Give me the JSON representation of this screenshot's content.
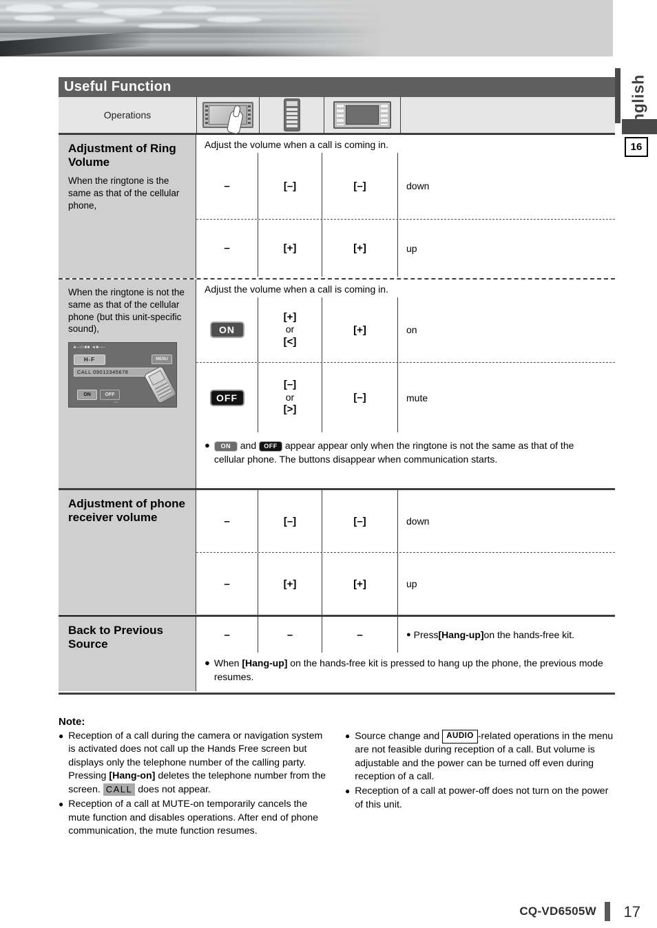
{
  "language_tab": "English",
  "chapter_number": "16",
  "header": {
    "title": "Useful Function",
    "operations_label": "Operations"
  },
  "icons": {
    "touchscreen": "touchscreen-hand-icon",
    "remote": "remote-control-icon",
    "head_unit": "head-unit-panel-icon"
  },
  "sections": [
    {
      "heading": "Adjustment of Ring Volume",
      "subtext": "When the ringtone is the same as that of the cellular phone,",
      "caption": "Adjust the volume when a call is coming in.",
      "rows": [
        {
          "touch": "–",
          "remote": "[–]",
          "unit": "[–]",
          "result": "down"
        },
        {
          "touch": "–",
          "remote": "[+]",
          "unit": "[+]",
          "result": "up"
        }
      ]
    },
    {
      "subtext": "When the ringtone is not the same as that of the cellular phone (but this unit-specific sound),",
      "caption": "Adjust the volume when a call is coming in.",
      "rows": [
        {
          "touch_button": "ON",
          "remote_a": "[+]",
          "remote_or": "or",
          "remote_b": "[<]",
          "unit": "[+]",
          "result": "on"
        },
        {
          "touch_button": "OFF",
          "remote_a": "[–]",
          "remote_or": "or",
          "remote_b": "[>]",
          "unit": "[–]",
          "result": "mute"
        }
      ],
      "note_pre": "",
      "note_mid": "and",
      "note_post": "appear appear only when the ringtone is not the same as that of the cellular phone. The buttons disappear when communication starts.",
      "note_pill_a": "ON",
      "note_pill_b": "OFF",
      "lcd": {
        "statusbar": "◄–‹/‹■■  ◄■–‹–",
        "hf_label": "H-F",
        "menu_label": "MENU",
        "call_text": "CALL  09012345678",
        "on_label": "ON",
        "off_label": "OFF",
        "foot_label": "• •"
      }
    },
    {
      "heading": "Adjustment of phone receiver volume",
      "rows": [
        {
          "touch": "–",
          "remote": "[–]",
          "unit": "[–]",
          "result": "down"
        },
        {
          "touch": "–",
          "remote": "[+]",
          "unit": "[+]",
          "result": "up"
        }
      ]
    },
    {
      "heading": "Back to Previous Source",
      "rows": [
        {
          "touch": "–",
          "remote": "–",
          "unit": "–",
          "result_pre": "Press ",
          "result_bold": "[Hang-up]",
          "result_post": " on the hands-free kit."
        }
      ],
      "note_pre": "When ",
      "note_bold": "[Hang-up]",
      "note_post": " on the hands-free kit is pressed to hang up the phone, the previous mode resumes."
    }
  ],
  "notes": {
    "title": "Note:",
    "left": [
      {
        "part1": "Reception of a call during the camera or navigation system is activated does not call up the Hands Free screen but displays only the telephone number of the calling party. Pressing ",
        "bold1": "[Hang-on]",
        "part2": " deletes the telephone number from the screen. ",
        "badge": "CALL",
        "part3": " does not appear."
      },
      {
        "part1": "Reception of a call at MUTE-on temporarily cancels the mute function and disables operations. After end of phone communication, the mute function resumes."
      }
    ],
    "right": [
      {
        "part1": "Source change and ",
        "badge": "AUDIO",
        "part2": "-related operations in the menu are not feasible during reception of a call. But volume is adjustable and the power can be turned off even during reception of a call."
      },
      {
        "part1": "Reception of a call at power-off does not turn on the power of this unit."
      }
    ]
  },
  "footer": {
    "model": "CQ-VD6505W",
    "page": "17"
  }
}
